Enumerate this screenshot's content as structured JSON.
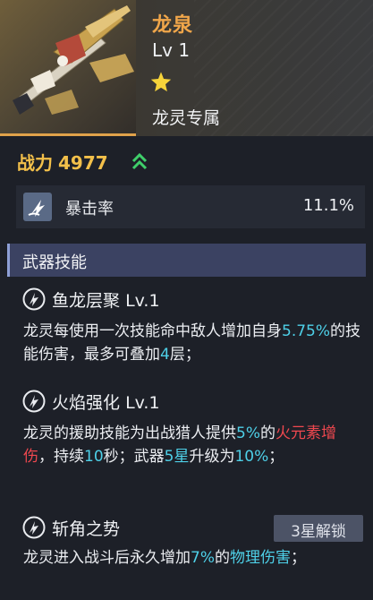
{
  "weapon": {
    "name": "龙泉",
    "level": "Lv 1",
    "stars": 1,
    "exclusive": "龙灵专属"
  },
  "power": {
    "label": "战力",
    "value": "4977"
  },
  "stat": {
    "label": "暴击率",
    "value": "11.1%"
  },
  "section_title": "武器技能",
  "skills": [
    {
      "name": "鱼龙层聚",
      "level": "Lv.1",
      "desc": [
        {
          "text": "龙灵每使用一次技能命中敌人增加自身",
          "style": "normal"
        },
        {
          "text": "5.75%",
          "style": "cyan"
        },
        {
          "text": "的技能伤害，最多可叠加",
          "style": "normal"
        },
        {
          "text": "4",
          "style": "cyan"
        },
        {
          "text": "层；",
          "style": "normal"
        }
      ]
    },
    {
      "name": "火焰强化",
      "level": "Lv.1",
      "desc": [
        {
          "text": "龙灵的援助技能为出战猎人提供",
          "style": "normal"
        },
        {
          "text": "5%",
          "style": "cyan"
        },
        {
          "text": "的",
          "style": "normal"
        },
        {
          "text": "火元素增伤",
          "style": "red"
        },
        {
          "text": "，持续",
          "style": "normal"
        },
        {
          "text": "10",
          "style": "cyan"
        },
        {
          "text": "秒；",
          "style": "normal"
        },
        {
          "text": "武器",
          "style": "normal"
        },
        {
          "text": "5星",
          "style": "cyan"
        },
        {
          "text": "升级为",
          "style": "normal"
        },
        {
          "text": "10%",
          "style": "cyan"
        },
        {
          "text": "；",
          "style": "normal"
        }
      ]
    },
    {
      "name": "斩角之势",
      "level": "",
      "badge": "3星解锁",
      "desc": [
        {
          "text": "龙灵进入战斗后永久增加",
          "style": "normal"
        },
        {
          "text": "7%",
          "style": "cyan"
        },
        {
          "text": "的",
          "style": "normal"
        },
        {
          "text": "物理伤害",
          "style": "cyan"
        },
        {
          "text": "；",
          "style": "normal"
        }
      ]
    }
  ],
  "colors": {
    "accent_orange": "#f0a64a",
    "power_gold": "#f3c04a",
    "highlight_cyan": "#4ed0e8",
    "highlight_red": "#f0484f",
    "upgrade_green": "#3fcf6a"
  },
  "icons": {
    "weapon_art": "weapon-art",
    "star": "star-icon",
    "power_up": "upgrade-arrows-icon",
    "crit": "crit-icon",
    "skill": "skill-swirl-icon"
  }
}
